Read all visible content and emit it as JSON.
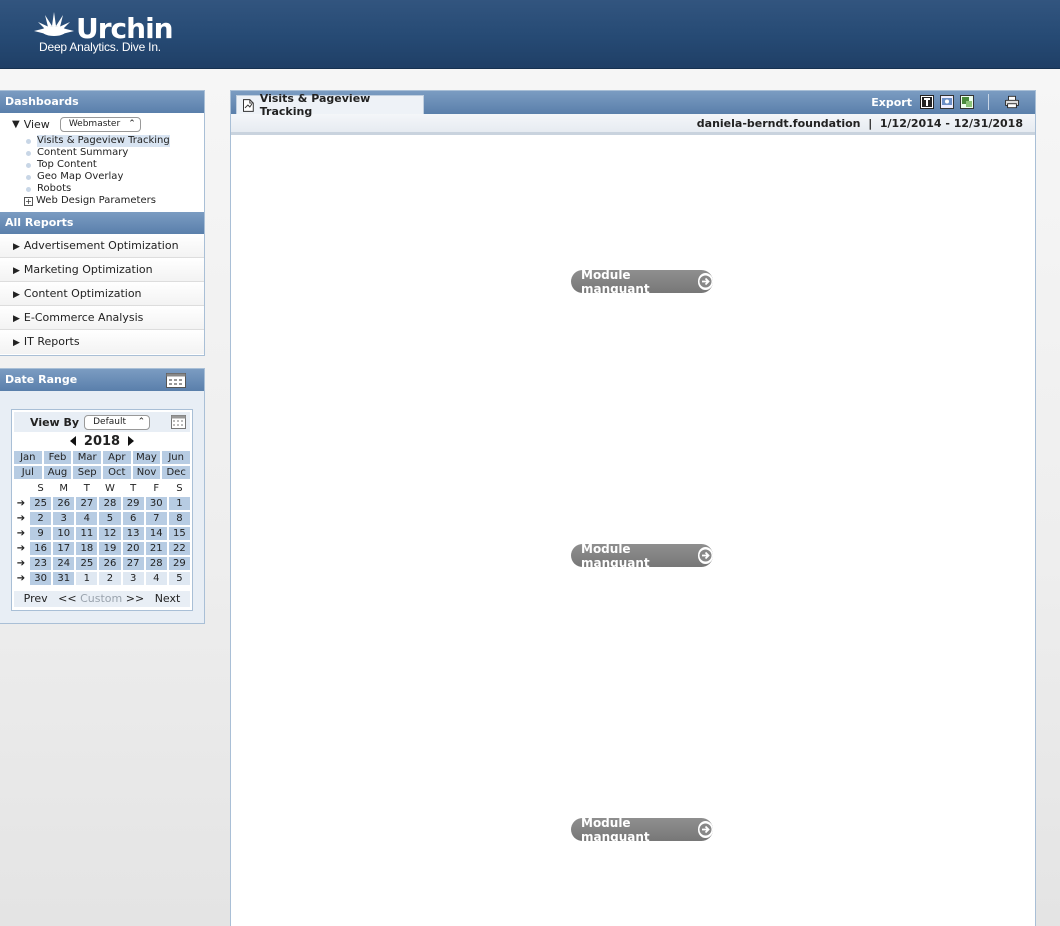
{
  "header": {
    "logo_text": "Urchin",
    "tagline": "Deep Analytics. Dive In."
  },
  "dashboards": {
    "title": "Dashboards",
    "view_label": "View",
    "view_value": "Webmaster",
    "items": [
      {
        "label": "Visits & Pageview Tracking",
        "type": "item",
        "active": true
      },
      {
        "label": "Content Summary",
        "type": "item"
      },
      {
        "label": "Top Content",
        "type": "item"
      },
      {
        "label": "Geo Map Overlay",
        "type": "item"
      },
      {
        "label": "Robots",
        "type": "item"
      },
      {
        "label": "Web Design Parameters",
        "type": "expandable"
      }
    ]
  },
  "all_reports": {
    "title": "All Reports",
    "items": [
      {
        "label": "Advertisement Optimization"
      },
      {
        "label": "Marketing Optimization"
      },
      {
        "label": "Content Optimization"
      },
      {
        "label": "E-Commerce Analysis"
      },
      {
        "label": "IT Reports"
      }
    ]
  },
  "date_range": {
    "title": "Date Range",
    "view_by_label": "View By",
    "view_by_value": "Default",
    "year": "2018",
    "months": [
      "Jan",
      "Feb",
      "Mar",
      "Apr",
      "May",
      "Jun",
      "Jul",
      "Aug",
      "Sep",
      "Oct",
      "Nov",
      "Dec"
    ],
    "weekdays": [
      "S",
      "M",
      "T",
      "W",
      "T",
      "F",
      "S"
    ],
    "weeks": [
      [
        "25",
        "26",
        "27",
        "28",
        "29",
        "30",
        "1"
      ],
      [
        "2",
        "3",
        "4",
        "5",
        "6",
        "7",
        "8"
      ],
      [
        "9",
        "10",
        "11",
        "12",
        "13",
        "14",
        "15"
      ],
      [
        "16",
        "17",
        "18",
        "19",
        "20",
        "21",
        "22"
      ],
      [
        "23",
        "24",
        "25",
        "26",
        "27",
        "28",
        "29"
      ],
      [
        "30",
        "31",
        "1",
        "2",
        "3",
        "4",
        "5"
      ]
    ],
    "week_arrow": "➔",
    "prev": "Prev",
    "custom": "Custom",
    "next": "Next",
    "prev_chevrons": "<<",
    "next_chevrons": ">>"
  },
  "main": {
    "tab_title": "Visits & Pageview Tracking",
    "export_label": "Export",
    "site": "daniela-berndt.foundation",
    "separator": "|",
    "range": "1/12/2014 - 12/31/2018",
    "modules": [
      {
        "label": "Module manquant"
      },
      {
        "label": "Module manquant"
      },
      {
        "label": "Module manquant"
      }
    ]
  },
  "colors": {
    "header_bg": "#264a74",
    "panel_head": "#6a8db7",
    "cal_cell": "#b7cce3",
    "module_bg": "#808080"
  }
}
